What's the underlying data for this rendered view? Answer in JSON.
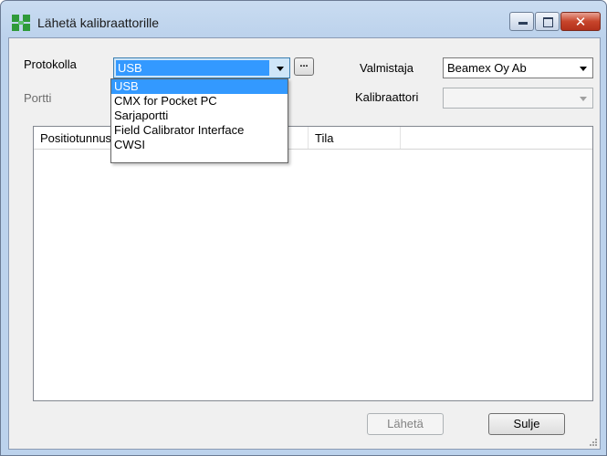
{
  "window": {
    "title": "Lähetä kalibraattorille",
    "close_glyph": "✕"
  },
  "form": {
    "protocol_label": "Protokolla",
    "protocol_value": "USB",
    "browse_label": "...",
    "manufacturer_label": "Valmistaja",
    "manufacturer_value": "Beamex Oy Ab",
    "port_label": "Portti",
    "calibrator_label": "Kalibraattori",
    "calibrator_value": ""
  },
  "list": {
    "columns": [
      "Positiotunnus",
      "Tila"
    ]
  },
  "dropdown": {
    "items": [
      "USB",
      "CMX for Pocket PC",
      "Sarjaportti",
      "Field Calibrator Interface",
      "CWSI"
    ],
    "selected_index": 0
  },
  "buttons": {
    "send": "Lähetä",
    "close": "Sulje"
  },
  "icons": {
    "app": "app-tree-icon",
    "minimize": "minimize-icon",
    "maximize": "maximize-icon",
    "close": "close-icon",
    "dropdown_arrow": "chevron-down-icon",
    "size_grip": "resize-grip-icon"
  },
  "colors": {
    "selection": "#3399ff",
    "close_button": "#c7452b",
    "title_bar": "#c9dcf1"
  }
}
